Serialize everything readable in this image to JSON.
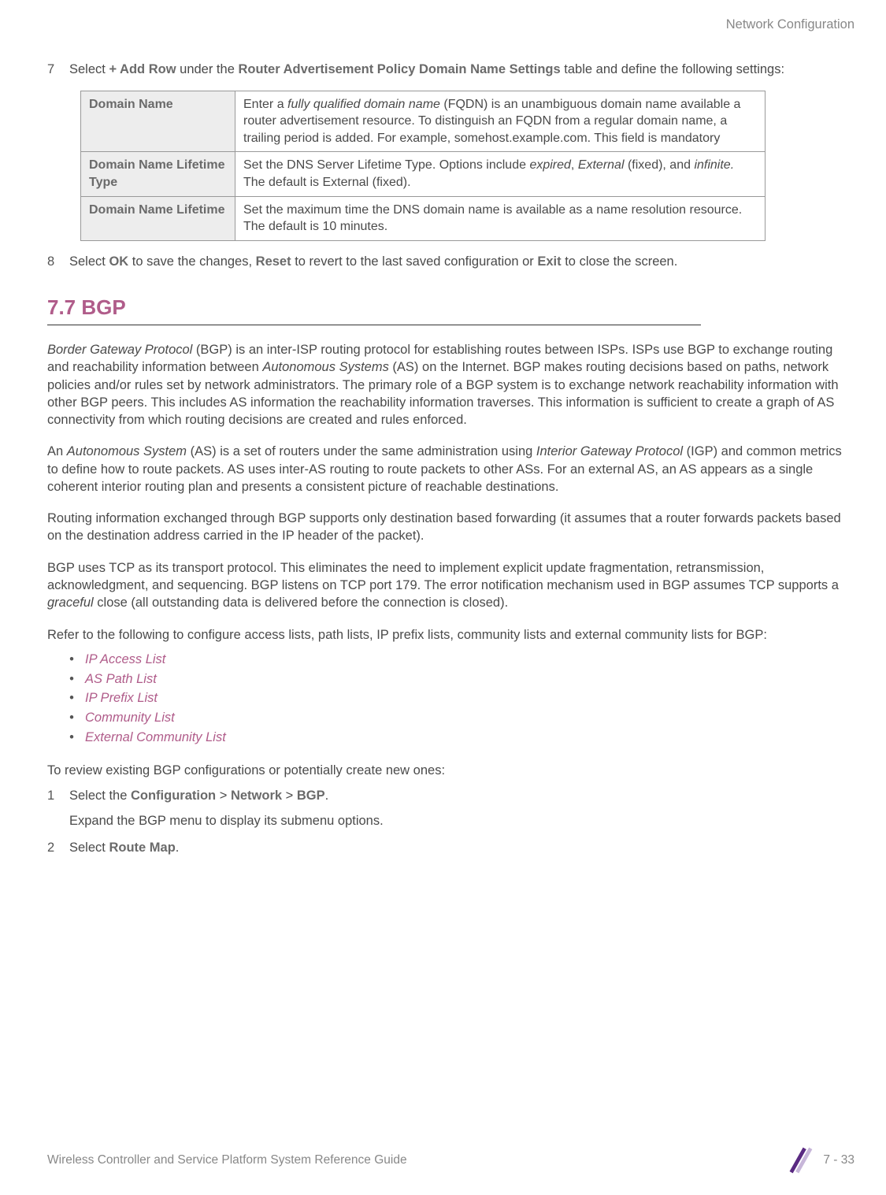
{
  "header": {
    "chapter": "Network Configuration"
  },
  "step7": {
    "num": "7",
    "text_pre": "Select ",
    "add_row": "+ Add Row",
    "text_mid": " under the ",
    "table_name": "Router Advertisement Policy Domain Name Settings",
    "text_post": " table and define the following settings:"
  },
  "table": {
    "rows": [
      {
        "label": "Domain Name",
        "desc_pre": "Enter a ",
        "desc_em": "fully qualified domain name",
        "desc_post": " (FQDN) is an unambiguous domain name available a router advertisement resource. To distinguish an FQDN from a regular domain name, a trailing period is added. For example, somehost.example.com. This field is mandatory"
      },
      {
        "label": "Domain Name Lifetime Type",
        "desc_pre": "Set the DNS Server Lifetime Type. Options include ",
        "desc_em1": "expired",
        "desc_mid1": ", ",
        "desc_em2": "External",
        "desc_mid2": " (fixed), and ",
        "desc_em3": "infinite.",
        "desc_post": " The default is External (fixed)."
      },
      {
        "label": "Domain Name Lifetime",
        "desc": "Set the maximum time the DNS domain name is available as a name resolution resource. The default is 10 minutes."
      }
    ]
  },
  "step8": {
    "num": "8",
    "text_pre": "Select ",
    "ok": "OK",
    "text_mid1": " to save the changes, ",
    "reset": "Reset",
    "text_mid2": " to revert to the last saved configuration or ",
    "exit": "Exit",
    "text_post": " to close the screen."
  },
  "section": {
    "title": "7.7 BGP"
  },
  "p1": {
    "em1": "Border Gateway Protocol",
    "t1": " (BGP) is an inter-ISP routing protocol for establishing routes between ISPs. ISPs use BGP to exchange routing and reachability information between ",
    "em2": "Autonomous Systems",
    "t2": " (AS) on the Internet. BGP makes routing decisions based on paths, network policies and/or rules set by network administrators. The primary role of a BGP system is to exchange network reachability information with other BGP peers. This includes AS information the reachability information traverses. This information is sufficient to create a graph of AS connectivity from which routing decisions are created and rules enforced."
  },
  "p2": {
    "t0": "An ",
    "em1": "Autonomous System",
    "t1": " (AS) is a set of routers under the same administration using ",
    "em2": "Interior Gateway Protocol",
    "t2": " (IGP) and common metrics to define how to route packets. AS uses inter-AS routing to route packets to other ASs. For an external AS, an AS appears as a single coherent interior routing plan and presents a consistent picture of reachable destinations."
  },
  "p3": "Routing information exchanged through BGP supports only destination based forwarding (it assumes that a router forwards packets based on the destination address carried in the IP header of the packet).",
  "p4": {
    "t1": "BGP uses TCP as its transport protocol. This eliminates the need to implement explicit update fragmentation, retransmission, acknowledgment, and sequencing. BGP listens on TCP port 179. The error notification mechanism used in BGP assumes TCP supports a ",
    "em1": "graceful",
    "t2": " close (all outstanding data is delivered before the connection is closed)."
  },
  "p5": "Refer to the following to configure access lists, path lists, IP prefix lists, community lists and external community lists for BGP:",
  "links": [
    "IP Access List",
    "AS Path List",
    "IP Prefix List",
    "Community List",
    "External Community List"
  ],
  "p6": "To review existing BGP configurations or potentially create new ones:",
  "step1b": {
    "num": "1",
    "t0": "Select the ",
    "b1": "Configuration",
    "sep1": " > ",
    "b2": "Network",
    "sep2": " > ",
    "b3": "BGP",
    "t1": ".",
    "sub": "Expand the BGP menu to display its submenu options."
  },
  "step2b": {
    "num": "2",
    "t0": "Select ",
    "b1": "Route Map",
    "t1": "."
  },
  "footer": {
    "left": "Wireless Controller and Service Platform System Reference Guide",
    "page": "7 - 33"
  }
}
